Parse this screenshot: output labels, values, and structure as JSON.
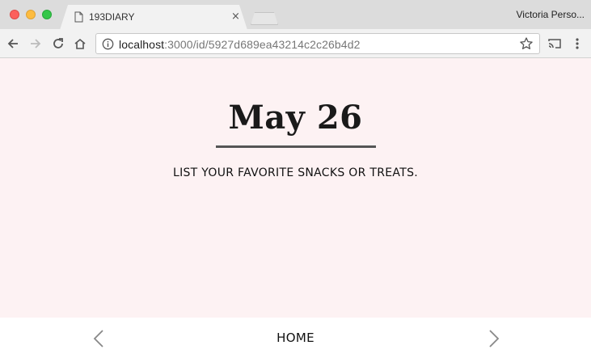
{
  "browser": {
    "tab_title": "193DIARY",
    "tab_close_glyph": "×",
    "profile_name": "Victoria Perso...",
    "url_host": "localhost",
    "url_rest": ":3000/id/5927d689ea43214c2c26b4d2",
    "icons": [
      "page-icon",
      "close-icon",
      "back-arrow-icon",
      "forward-arrow-icon",
      "reload-icon",
      "home-icon",
      "info-icon",
      "star-icon",
      "cast-icon",
      "menu-dots-icon"
    ]
  },
  "entry": {
    "date": "May 26",
    "prompt": "LIST YOUR FAVORITE SNACKS OR TREATS."
  },
  "nav": {
    "home_label": "HOME",
    "prev_icon": "chevron-left-icon",
    "next_icon": "chevron-right-icon"
  },
  "colors": {
    "page_background": "#fdf2f3",
    "rule": "#555555",
    "text": "#111111"
  }
}
